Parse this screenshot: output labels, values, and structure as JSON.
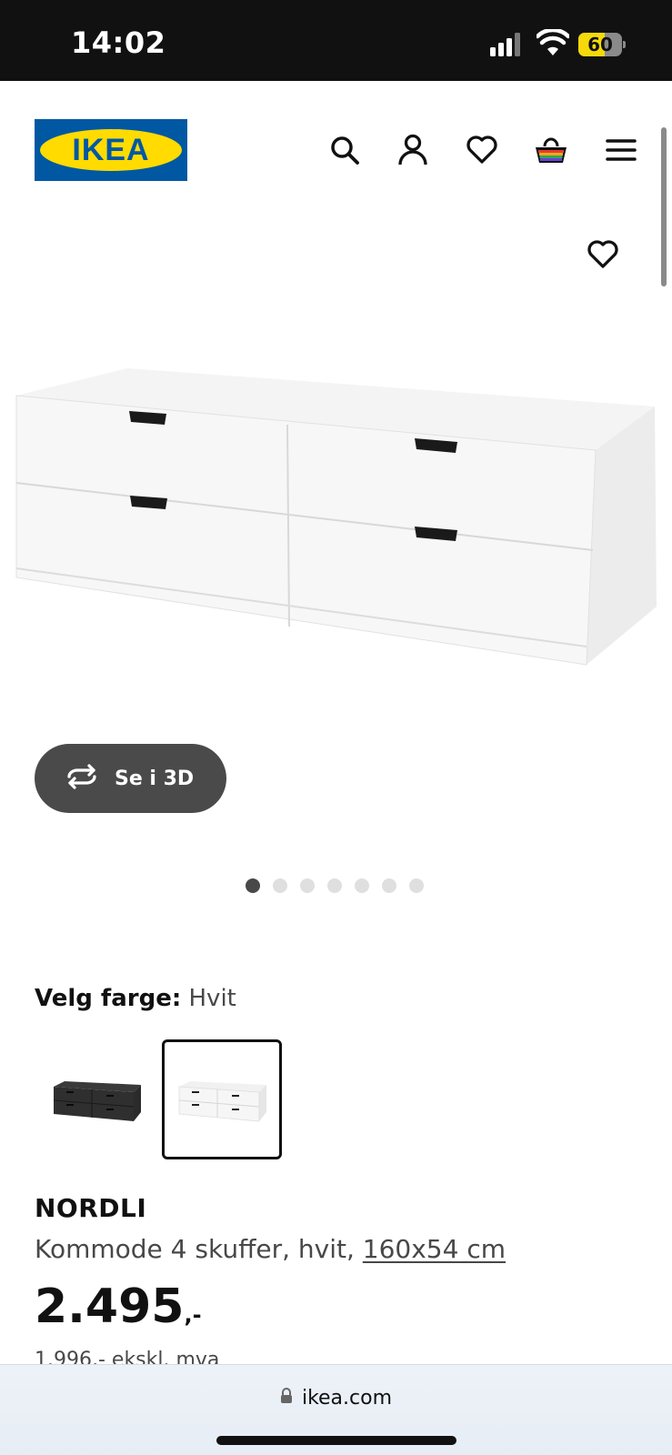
{
  "status_bar": {
    "time": "14:02",
    "battery_percent": "60",
    "battery_level": 0.6
  },
  "header": {
    "logo_text": "IKEA",
    "icons": [
      "search-icon",
      "account-icon",
      "heart-icon",
      "basket-icon",
      "menu-icon"
    ]
  },
  "gallery": {
    "view_3d_label": "Se i 3D",
    "image_count": 7,
    "active_index": 0
  },
  "color_picker": {
    "label": "Velg farge:",
    "selected_value": "Hvit",
    "options": [
      "black",
      "white"
    ]
  },
  "product": {
    "name": "NORDLI",
    "description": "Kommode 4 skuffer, hvit, ",
    "size": "160x54 cm",
    "price_main": "2.495",
    "price_suffix": ",-",
    "price_ex_vat": "1.996,- ekskl. mva"
  },
  "browser": {
    "url": "ikea.com"
  },
  "colors": {
    "ikea_blue": "#0058a3",
    "ikea_yellow": "#ffdb00",
    "status_bg": "#111111",
    "button_dark": "#4a4a4a"
  }
}
